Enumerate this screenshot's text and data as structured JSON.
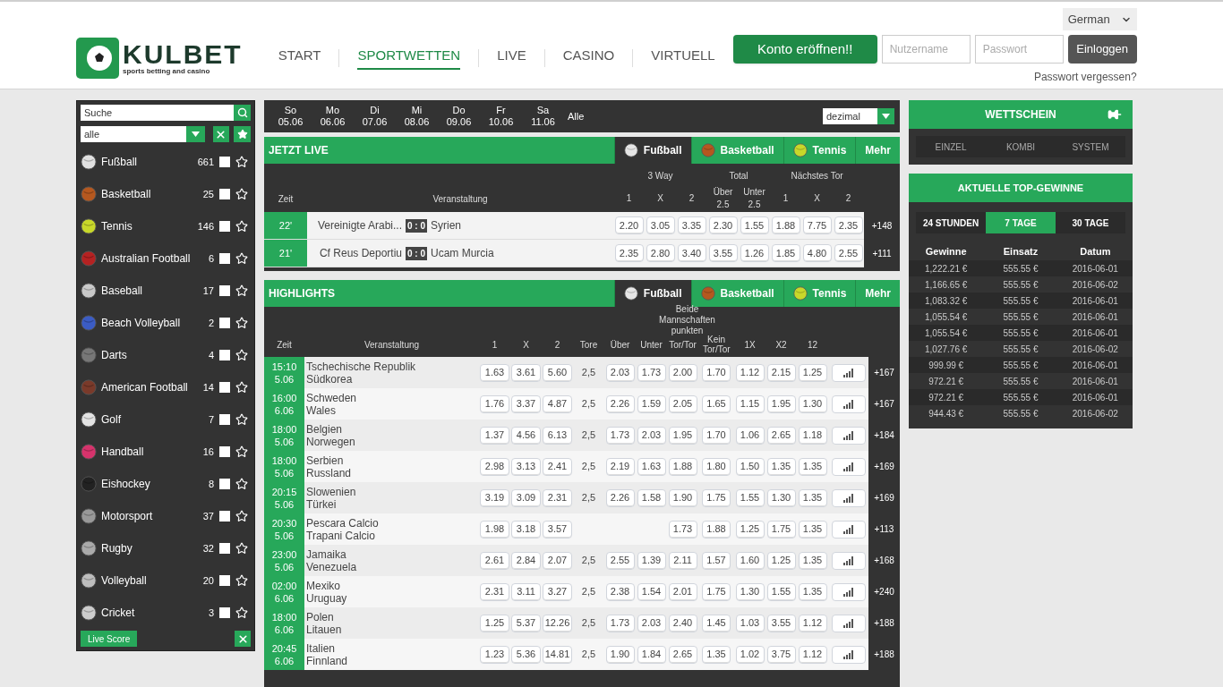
{
  "header": {
    "logo": {
      "name": "KULBET",
      "tagline": "sports betting and casino"
    },
    "nav": [
      {
        "label": "START",
        "selected": false
      },
      {
        "label": "SPORTWETTEN",
        "selected": true
      },
      {
        "label": "LIVE",
        "selected": false
      },
      {
        "label": "CASINO",
        "selected": false
      },
      {
        "label": "VIRTUELL",
        "selected": false
      }
    ],
    "language": "German",
    "signup": "Konto eröffnen!!",
    "username": {
      "placeholder": "Nutzername"
    },
    "password": {
      "placeholder": "Passwort"
    },
    "login": "Einloggen",
    "forgot": "Passwort vergessen?"
  },
  "sidebar": {
    "search": {
      "placeholder": "Suche"
    },
    "filter": "alle",
    "sports": [
      {
        "name": "Fußball",
        "count": "661",
        "checked": false,
        "color": "#e0e0e0"
      },
      {
        "name": "Basketball",
        "count": "25",
        "checked": false,
        "color": "#b5581f"
      },
      {
        "name": "Tennis",
        "count": "146",
        "checked": false,
        "color": "#c8d82a"
      },
      {
        "name": "Australian Football",
        "count": "6",
        "checked": false,
        "color": "#b52222"
      },
      {
        "name": "Baseball",
        "count": "17",
        "checked": false,
        "color": "#c9c9c9"
      },
      {
        "name": "Beach Volleyball",
        "count": "2",
        "checked": false,
        "color": "#3b5cc4"
      },
      {
        "name": "Darts",
        "count": "4",
        "checked": false,
        "color": "#777777"
      },
      {
        "name": "American Football",
        "count": "14",
        "checked": false,
        "color": "#7a3a2a"
      },
      {
        "name": "Golf",
        "count": "7",
        "checked": false,
        "color": "#e3e3e3"
      },
      {
        "name": "Handball",
        "count": "16",
        "checked": false,
        "color": "#d6336c"
      },
      {
        "name": "Eishockey",
        "count": "8",
        "checked": false,
        "color": "#222222"
      },
      {
        "name": "Motorsport",
        "count": "37",
        "checked": false,
        "color": "#999999"
      },
      {
        "name": "Rugby",
        "count": "32",
        "checked": false,
        "color": "#aaaaaa"
      },
      {
        "name": "Volleyball",
        "count": "20",
        "checked": false,
        "color": "#bdbdbd"
      },
      {
        "name": "Cricket",
        "count": "3",
        "checked": false,
        "color": "#cccccc"
      }
    ],
    "live_score": "Live Score"
  },
  "dates": {
    "days": [
      {
        "day": "So",
        "date": "05.06",
        "selected": false
      },
      {
        "day": "Mo",
        "date": "06.06",
        "selected": false
      },
      {
        "day": "Di",
        "date": "07.06",
        "selected": false
      },
      {
        "day": "Mi",
        "date": "08.06",
        "selected": false
      },
      {
        "day": "Do",
        "date": "09.06",
        "selected": false
      },
      {
        "day": "Fr",
        "date": "10.06",
        "selected": false
      },
      {
        "day": "Sa",
        "date": "11.06",
        "selected": false
      }
    ],
    "all": "Alle",
    "odds_format": "dezimal"
  },
  "live": {
    "title": "JETZT LIVE",
    "tabs": [
      {
        "label": "Fußball",
        "selected": true,
        "color": "#e6e6e6"
      },
      {
        "label": "Basketball",
        "selected": false,
        "color": "#b5581f"
      },
      {
        "label": "Tennis",
        "selected": false,
        "color": "#c8d82a"
      },
      {
        "label": "Mehr",
        "selected": false
      }
    ],
    "groups": [
      "3 Way",
      "Total",
      "Nächstes Tor"
    ],
    "columns": [
      "Zeit",
      "Veranstaltung",
      "1",
      "X",
      "2",
      "Über 2.5",
      "Unter 2.5",
      "1",
      "X",
      "2"
    ],
    "rows": [
      {
        "time": "22'",
        "home": "Vereinigte Arabi...",
        "score": "0 : 0",
        "away": "Syrien",
        "odds": [
          "2.20",
          "3.05",
          "3.35",
          "2.30",
          "1.55",
          "1.88",
          "7.75",
          "2.35"
        ],
        "more": "+148"
      },
      {
        "time": "21'",
        "home": "Cf Reus Deportiu",
        "score": "0 : 0",
        "away": "Ucam Murcia",
        "odds": [
          "2.35",
          "2.80",
          "3.40",
          "3.55",
          "1.26",
          "1.85",
          "4.80",
          "2.55"
        ],
        "more": "+111"
      }
    ]
  },
  "highlights": {
    "title": "HIGHLIGHTS",
    "tabs": [
      {
        "label": "Fußball",
        "selected": true,
        "color": "#e6e6e6"
      },
      {
        "label": "Basketball",
        "selected": false,
        "color": "#b5581f"
      },
      {
        "label": "Tennis",
        "selected": false,
        "color": "#c8d82a"
      },
      {
        "label": "Mehr",
        "selected": false
      }
    ],
    "group": "Beide Mannschaften punkten",
    "columns": [
      "Zeit",
      "Veranstaltung",
      "1",
      "X",
      "2",
      "Tore",
      "Über",
      "Unter",
      "Tor/Tor",
      "Kein Tor/Tor",
      "1X",
      "X2",
      "12"
    ],
    "rows": [
      {
        "time": "15:10",
        "date": "5.06",
        "home": "Tschechische Republik",
        "away": "Südkorea",
        "odds": [
          "1.63",
          "3.61",
          "5.60"
        ],
        "total": {
          "line": "2,5",
          "over": "2.03",
          "under": "1.73"
        },
        "btts": [
          "2.00",
          "1.70"
        ],
        "double": [
          "1.12",
          "2.15",
          "1.25"
        ],
        "more": "+167"
      },
      {
        "time": "16:00",
        "date": "6.06",
        "home": "Schweden",
        "away": "Wales",
        "odds": [
          "1.76",
          "3.37",
          "4.87"
        ],
        "total": {
          "line": "2,5",
          "over": "2.26",
          "under": "1.59"
        },
        "btts": [
          "2.05",
          "1.65"
        ],
        "double": [
          "1.15",
          "1.95",
          "1.30"
        ],
        "more": "+167"
      },
      {
        "time": "18:00",
        "date": "5.06",
        "home": "Belgien",
        "away": "Norwegen",
        "odds": [
          "1.37",
          "4.56",
          "6.13"
        ],
        "total": {
          "line": "2,5",
          "over": "1.73",
          "under": "2.03"
        },
        "btts": [
          "1.95",
          "1.70"
        ],
        "double": [
          "1.06",
          "2.65",
          "1.18"
        ],
        "more": "+184"
      },
      {
        "time": "18:00",
        "date": "5.06",
        "home": "Serbien",
        "away": "Russland",
        "odds": [
          "2.98",
          "3.13",
          "2.41"
        ],
        "total": {
          "line": "2,5",
          "over": "2.19",
          "under": "1.63"
        },
        "btts": [
          "1.88",
          "1.80"
        ],
        "double": [
          "1.50",
          "1.35",
          "1.35"
        ],
        "more": "+169"
      },
      {
        "time": "20:15",
        "date": "5.06",
        "home": "Slowenien",
        "away": "Türkei",
        "odds": [
          "3.19",
          "3.09",
          "2.31"
        ],
        "total": {
          "line": "2,5",
          "over": "2.26",
          "under": "1.58"
        },
        "btts": [
          "1.90",
          "1.75"
        ],
        "double": [
          "1.55",
          "1.30",
          "1.35"
        ],
        "more": "+169"
      },
      {
        "time": "20:30",
        "date": "5.06",
        "home": "Pescara Calcio",
        "away": "Trapani Calcio",
        "odds": [
          "1.98",
          "3.18",
          "3.57"
        ],
        "btts": [
          "1.73",
          "1.88"
        ],
        "double": [
          "1.25",
          "1.75",
          "1.35"
        ],
        "more": "+113"
      },
      {
        "time": "23:00",
        "date": "5.06",
        "home": "Jamaika",
        "away": "Venezuela",
        "odds": [
          "2.61",
          "2.84",
          "2.07"
        ],
        "total": {
          "line": "2,5",
          "over": "2.55",
          "under": "1.39"
        },
        "btts": [
          "2.11",
          "1.57"
        ],
        "double": [
          "1.60",
          "1.25",
          "1.35"
        ],
        "more": "+168"
      },
      {
        "time": "02:00",
        "date": "6.06",
        "home": "Mexiko",
        "away": "Uruguay",
        "odds": [
          "2.31",
          "3.11",
          "3.27"
        ],
        "total": {
          "line": "2,5",
          "over": "2.38",
          "under": "1.54"
        },
        "btts": [
          "2.01",
          "1.75"
        ],
        "double": [
          "1.30",
          "1.55",
          "1.35"
        ],
        "more": "+240"
      },
      {
        "time": "18:00",
        "date": "6.06",
        "home": "Polen",
        "away": "Litauen",
        "odds": [
          "1.25",
          "5.37",
          "12.26"
        ],
        "total": {
          "line": "2,5",
          "over": "1.73",
          "under": "2.03"
        },
        "btts": [
          "2.40",
          "1.45"
        ],
        "double": [
          "1.03",
          "3.55",
          "1.12"
        ],
        "more": "+188"
      },
      {
        "time": "20:45",
        "date": "6.06",
        "home": "Italien",
        "away": "Finnland",
        "odds": [
          "1.23",
          "5.36",
          "14.81"
        ],
        "total": {
          "line": "2,5",
          "over": "1.90",
          "under": "1.84"
        },
        "btts": [
          "2.65",
          "1.35"
        ],
        "double": [
          "1.02",
          "3.75",
          "1.12"
        ],
        "more": "+188"
      }
    ]
  },
  "betslip": {
    "title": "WETTSCHEIN",
    "tabs": [
      {
        "label": "EINZEL",
        "selected": false
      },
      {
        "label": "KOMBI",
        "selected": false
      },
      {
        "label": "SYSTEM",
        "selected": false
      }
    ]
  },
  "top_wins": {
    "title": "AKTUELLE TOP-GEWINNE",
    "periods": [
      {
        "label": "24 STUNDEN",
        "selected": false
      },
      {
        "label": "7 TAGE",
        "selected": true
      },
      {
        "label": "30 TAGE",
        "selected": false
      }
    ],
    "columns": [
      "Gewinne",
      "Einsatz",
      "Datum"
    ],
    "rows": [
      [
        "1,222.21 €",
        "555.55 €",
        "2016-06-01"
      ],
      [
        "1,166.65 €",
        "555.55 €",
        "2016-06-02"
      ],
      [
        "1,083.32 €",
        "555.55 €",
        "2016-06-01"
      ],
      [
        "1,055.54 €",
        "555.55 €",
        "2016-06-01"
      ],
      [
        "1,055.54 €",
        "555.55 €",
        "2016-06-01"
      ],
      [
        "1,027.76 €",
        "555.55 €",
        "2016-06-02"
      ],
      [
        "999.99 €",
        "555.55 €",
        "2016-06-01"
      ],
      [
        "972.21 €",
        "555.55 €",
        "2016-06-01"
      ],
      [
        "972.21 €",
        "555.55 €",
        "2016-06-01"
      ],
      [
        "944.43 €",
        "555.55 €",
        "2016-06-02"
      ]
    ]
  }
}
